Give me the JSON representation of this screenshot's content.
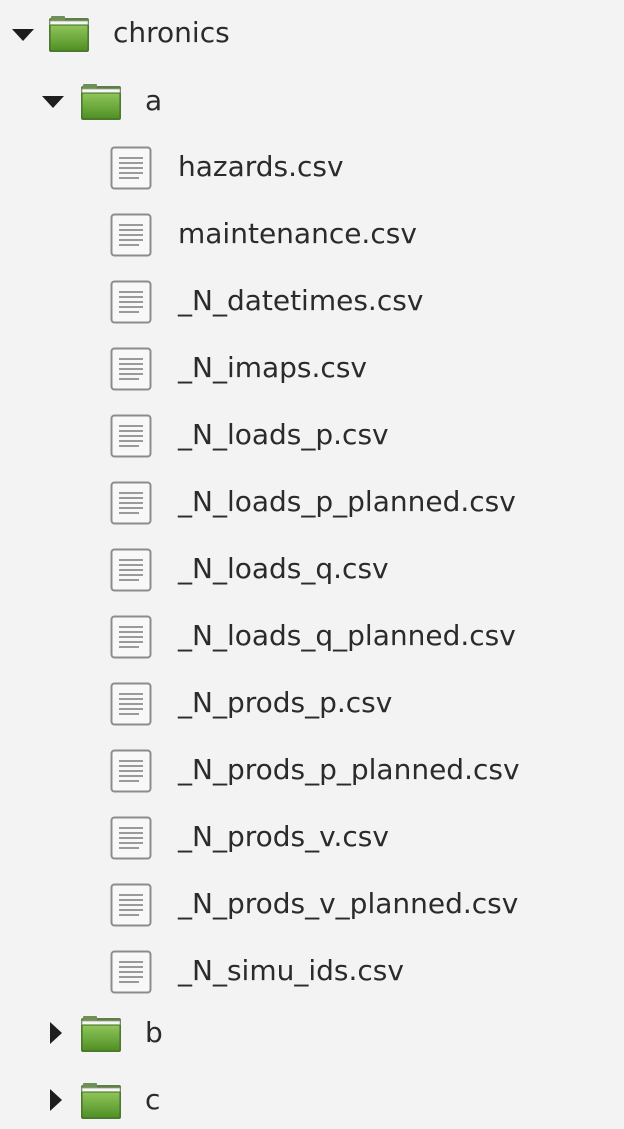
{
  "tree": {
    "root": {
      "label": "chronics",
      "expanded": true,
      "icon": "folder-icon",
      "color": "#5a9e2b"
    },
    "folder_a": {
      "label": "a",
      "expanded": true,
      "icon": "folder-icon",
      "files": [
        {
          "label": "hazards.csv",
          "icon": "text-file-icon"
        },
        {
          "label": "maintenance.csv",
          "icon": "text-file-icon"
        },
        {
          "label": "_N_datetimes.csv",
          "icon": "text-file-icon"
        },
        {
          "label": "_N_imaps.csv",
          "icon": "text-file-icon"
        },
        {
          "label": "_N_loads_p.csv",
          "icon": "text-file-icon"
        },
        {
          "label": "_N_loads_p_planned.csv",
          "icon": "text-file-icon"
        },
        {
          "label": "_N_loads_q.csv",
          "icon": "text-file-icon"
        },
        {
          "label": "_N_loads_q_planned.csv",
          "icon": "text-file-icon"
        },
        {
          "label": "_N_prods_p.csv",
          "icon": "text-file-icon"
        },
        {
          "label": "_N_prods_p_planned.csv",
          "icon": "text-file-icon"
        },
        {
          "label": "_N_prods_v.csv",
          "icon": "text-file-icon"
        },
        {
          "label": "_N_prods_v_planned.csv",
          "icon": "text-file-icon"
        },
        {
          "label": "_N_simu_ids.csv",
          "icon": "text-file-icon"
        }
      ]
    },
    "folder_b": {
      "label": "b",
      "expanded": false,
      "icon": "folder-icon"
    },
    "folder_c": {
      "label": "c",
      "expanded": false,
      "icon": "folder-icon"
    }
  }
}
